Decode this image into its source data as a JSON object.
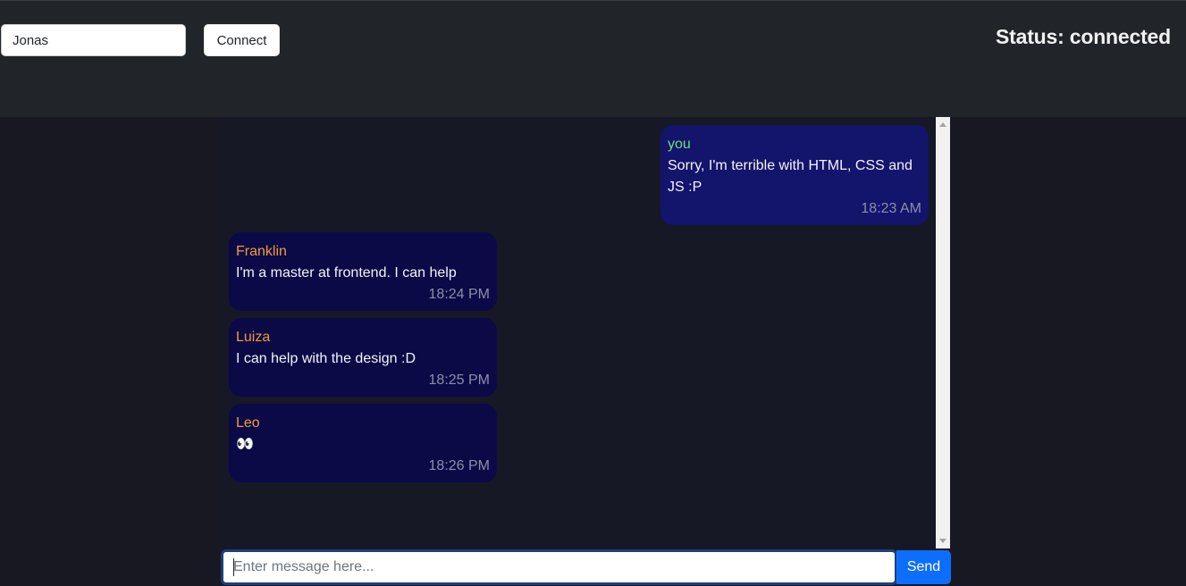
{
  "header": {
    "name_value": "Jonas",
    "connect_label": "Connect",
    "status_text": "Status: connected"
  },
  "messages": [
    {
      "sender": "you",
      "text": "Sorry, I'm terrible with HTML, CSS and JS :P",
      "time": "18:23 AM",
      "own": true
    },
    {
      "sender": "Franklin",
      "text": "I'm a master at frontend. I can help",
      "time": "18:24 PM",
      "own": false
    },
    {
      "sender": "Luiza",
      "text": "I can help with the design :D",
      "time": "18:25 PM",
      "own": false
    },
    {
      "sender": "Leo",
      "text": "👀",
      "time": "18:26 PM",
      "own": false
    }
  ],
  "composer": {
    "placeholder": "Enter message here...",
    "value": "",
    "send_label": "Send"
  },
  "colors": {
    "header_bg": "#212429",
    "page_bg": "#171821",
    "own_bubble": "#13146b",
    "other_bubble": "#0b0a47",
    "own_sender": "#6fe07a",
    "other_sender": "#f39a35",
    "send_button": "#0d6efd"
  }
}
